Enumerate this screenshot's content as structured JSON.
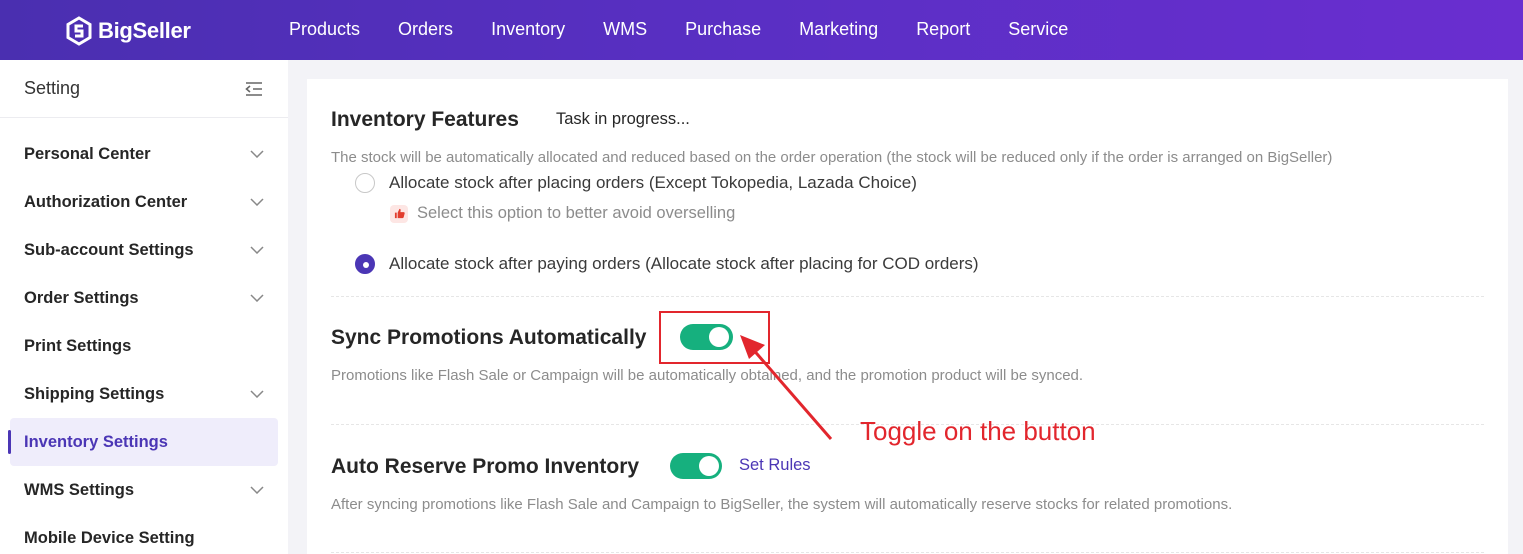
{
  "brand": {
    "name": "BigSeller"
  },
  "nav": {
    "items": [
      "Products",
      "Orders",
      "Inventory",
      "WMS",
      "Purchase",
      "Marketing",
      "Report",
      "Service"
    ]
  },
  "sidebar": {
    "title": "Setting",
    "items": [
      {
        "label": "Personal Center",
        "has_chevron": true
      },
      {
        "label": "Authorization Center",
        "has_chevron": true
      },
      {
        "label": "Sub-account Settings",
        "has_chevron": true
      },
      {
        "label": "Order Settings",
        "has_chevron": true
      },
      {
        "label": "Print Settings",
        "has_chevron": false
      },
      {
        "label": "Shipping Settings",
        "has_chevron": true
      },
      {
        "label": "Inventory Settings",
        "has_chevron": false,
        "active": true
      },
      {
        "label": "WMS Settings",
        "has_chevron": true
      },
      {
        "label": "Mobile Device Setting",
        "has_chevron": false
      }
    ]
  },
  "inventory_features": {
    "title": "Inventory Features",
    "status": "Task in progress...",
    "description": "The stock will be automatically allocated and reduced based on the order operation (the stock will be reduced only if the order is arranged on BigSeller)",
    "option_after_placing": {
      "label": "Allocate stock after placing orders (Except Tokopedia, Lazada Choice)",
      "checked": false
    },
    "tip": "Select this option to better avoid overselling",
    "option_after_paying": {
      "label": "Allocate stock after paying orders (Allocate stock after placing for COD orders)",
      "checked": true
    }
  },
  "sync_promotions": {
    "title": "Sync Promotions Automatically",
    "enabled": true,
    "description": "Promotions like Flash Sale or Campaign will be automatically obtained, and the promotion product will be synced."
  },
  "auto_reserve": {
    "title": "Auto Reserve Promo Inventory",
    "enabled": true,
    "link": "Set Rules",
    "description": "After syncing promotions like Flash Sale and Campaign to BigSeller, the system will automatically reserve stocks for related promotions."
  },
  "annotation": {
    "text": "Toggle on the button",
    "color": "#e2262d"
  },
  "colors": {
    "brand_purple": "#4b36b5",
    "toggle_green": "#16b07e"
  }
}
